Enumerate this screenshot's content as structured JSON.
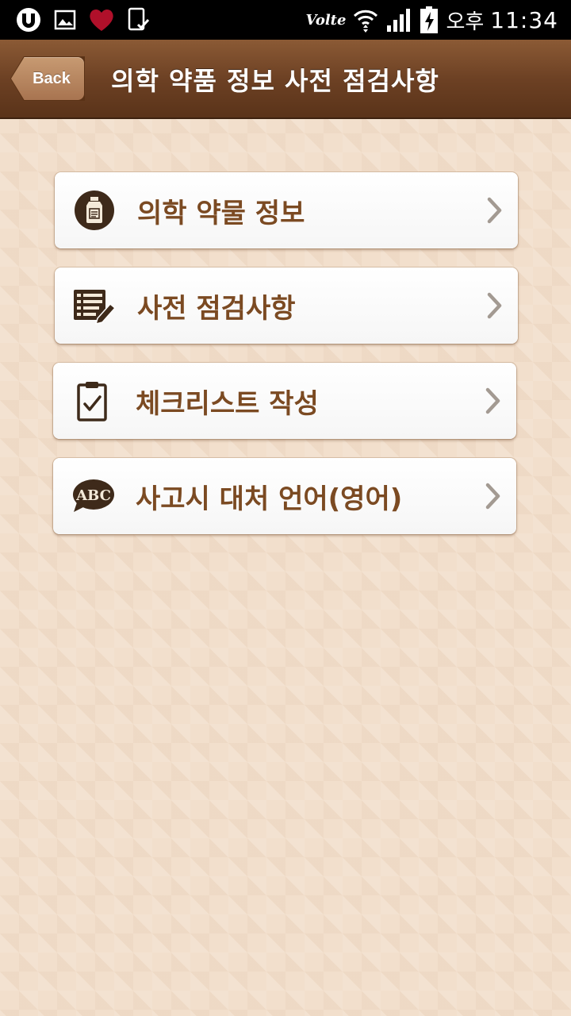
{
  "status_bar": {
    "volte": "Volte",
    "ampm": "오후",
    "time": "11:34"
  },
  "header": {
    "back_label": "Back",
    "title": "의학 약품 정보 사전 점검사항"
  },
  "menu": {
    "items": [
      {
        "label": "의학 약물 정보",
        "icon": "medicine-bottle-icon"
      },
      {
        "label": "사전 점검사항",
        "icon": "list-edit-icon"
      },
      {
        "label": "체크리스트 작성",
        "icon": "clipboard-check-icon"
      },
      {
        "label": "사고시 대처 언어(영어)",
        "icon": "abc-speech-bubble-icon"
      }
    ]
  },
  "colors": {
    "header_brown": "#6d4124",
    "label_brown": "#7b4a22",
    "background": "#f2dfcc"
  }
}
